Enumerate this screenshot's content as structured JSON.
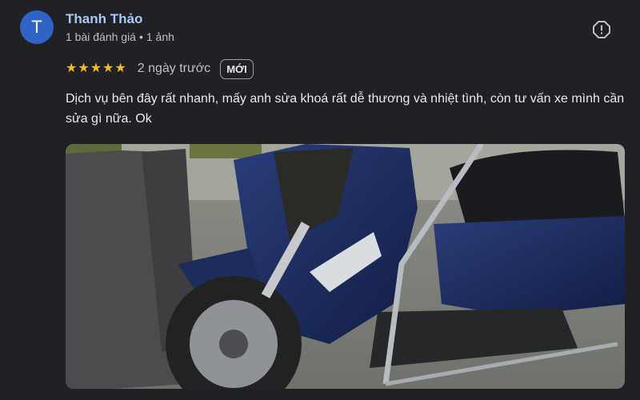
{
  "reviewer": {
    "avatar_initial": "T",
    "name": "Thanh Thảo",
    "review_count": "1 bài đánh giá",
    "separator": "•",
    "photo_count": "1 ảnh"
  },
  "rating": {
    "stars": 5,
    "max_stars": 5,
    "star_color": "#f7b928"
  },
  "posted": "2 ngày trước",
  "badge": "MỚI",
  "review_text": "Dịch vụ bên đây rất nhanh, mấy anh sửa khoá rất dễ thương và nhiệt tình, còn tư vấn xe mình cần sửa gì nữa. Ok",
  "icons": {
    "flag": "report-flag-icon"
  },
  "colors": {
    "background": "#202124",
    "avatar": "#2f64c6",
    "name": "#a8c7fa",
    "scooter_body": "#1b2a5a"
  }
}
